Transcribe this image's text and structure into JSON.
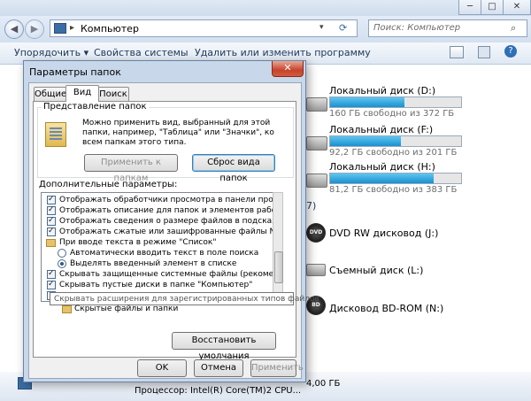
{
  "window": {
    "address": "Компьютер",
    "search_placeholder": "Поиск: Компьютер",
    "controls": {
      "minimize": "─",
      "maximize": "□",
      "close": "✕"
    }
  },
  "toolbar": {
    "organize": "Упорядочить ▾",
    "system_properties": "Свойства системы",
    "uninstall": "Удалить или изменить программу"
  },
  "drives": [
    {
      "name": "Локальный диск (D:)",
      "free": "160 ГБ свободно из 372 ГБ",
      "used_fraction": 0.57
    },
    {
      "name": "Локальный диск (F:)",
      "free": "92,2 ГБ свободно из 201 ГБ",
      "used_fraction": 0.54
    },
    {
      "name": "Локальный диск (H:)",
      "free": "81,2 ГБ свободно из 383 ГБ",
      "used_fraction": 0.79
    }
  ],
  "section_count": "7)",
  "removable": [
    {
      "name": "DVD RW дисковод (J:)",
      "badge": "DVD"
    },
    {
      "name": "Съемный диск (L:)",
      "badge": ""
    },
    {
      "name": "Дисковод BD-ROM (N:)",
      "badge": "BD"
    }
  ],
  "status": {
    "processor": "Процессор: Intel(R) Core(TM)2 CPU...",
    "memory": "4,00 ГБ"
  },
  "dialog": {
    "title": "Параметры папок",
    "close": "✕",
    "tabs": [
      "Общие",
      "Вид",
      "Поиск"
    ],
    "folder_views": {
      "legend": "Представление папок",
      "description": "Можно применить вид, выбранный для этой папки, например, \"Таблица\" или \"Значки\", ко всем папкам этого типа.",
      "apply_button": "Применить к папкам",
      "reset_button": "Сброс вида папок"
    },
    "advanced_label": "Дополнительные параметры:",
    "options": [
      {
        "kind": "check",
        "checked": true,
        "text": "Отображать обработчики просмотра в панели просм"
      },
      {
        "kind": "check",
        "checked": true,
        "text": "Отображать описание для папок и элементов рабоч"
      },
      {
        "kind": "check",
        "checked": true,
        "text": "Отображать сведения о размере файлов в подсказк"
      },
      {
        "kind": "check",
        "checked": true,
        "text": "Отображать сжатые или зашифрованные файлы NTI"
      },
      {
        "kind": "folder",
        "checked": false,
        "text": "При вводе текста в режиме \"Список\""
      },
      {
        "kind": "radio",
        "checked": false,
        "text": "Автоматически вводить текст в поле поиска"
      },
      {
        "kind": "radio",
        "checked": true,
        "text": "Выделять введенный элемент в списке"
      },
      {
        "kind": "check",
        "checked": true,
        "text": "Скрывать защищенные системные файлы (рекомен"
      },
      {
        "kind": "check",
        "checked": true,
        "text": "Скрывать пустые диски в папке \"Компьютер\""
      }
    ],
    "tooltip": "Скрывать расширения для зарегистрированных типов файлов",
    "hidden_files": "Скрытые файлы и папки",
    "restore_button": "Восстановить умолчания",
    "ok_button": "OK",
    "cancel_button": "Отмена",
    "apply_button": "Применить"
  },
  "colors": {
    "accent": "#1b8fcf",
    "close_red": "#c7432a"
  }
}
